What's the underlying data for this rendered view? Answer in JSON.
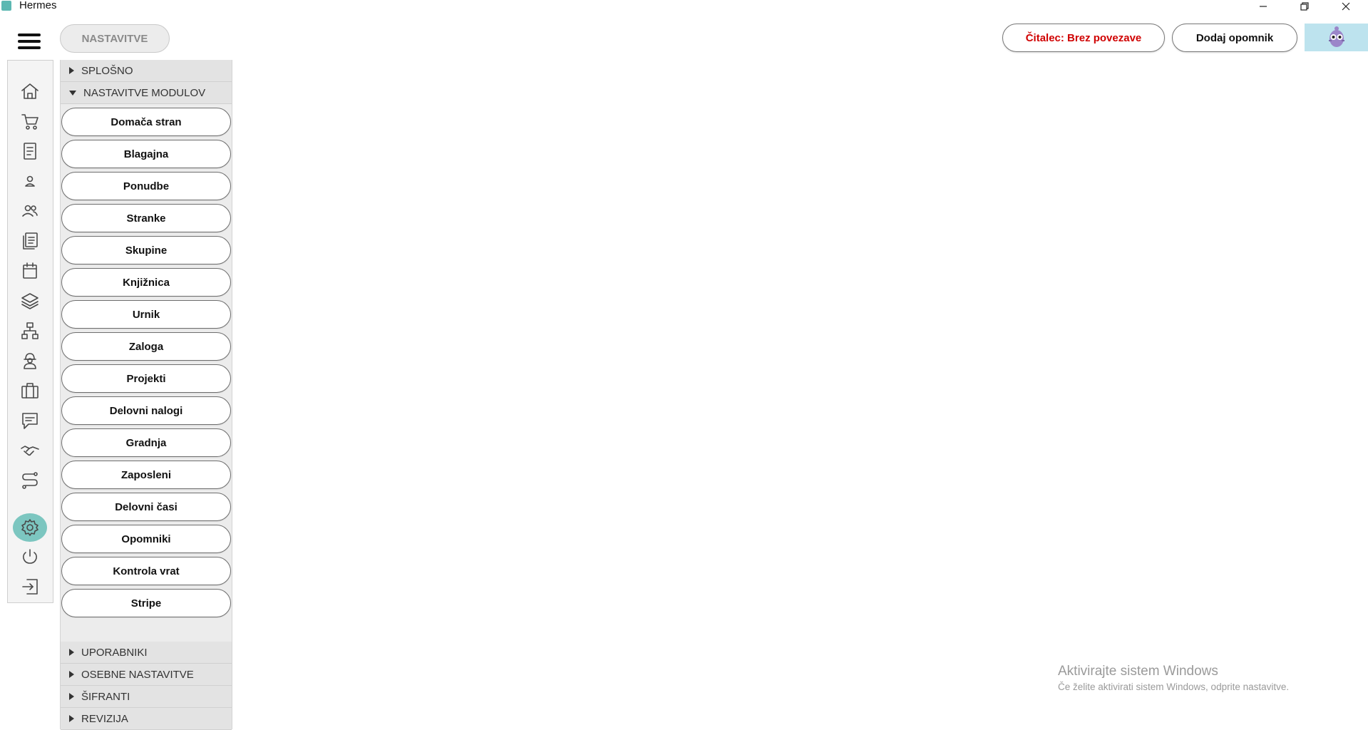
{
  "app": {
    "title": "Hermes"
  },
  "header": {
    "page_title": "NASTAVITVE",
    "reader_button": "Čitalec: Brez povezave",
    "reminder_button": "Dodaj opomnik",
    "reader_color": "#d00000"
  },
  "sidebar_icons": [
    "home-icon",
    "cart-icon",
    "document-icon",
    "user-icon",
    "users-icon",
    "list-icon",
    "calendar-icon",
    "layers-icon",
    "network-icon",
    "worker-icon",
    "briefcase-icon",
    "chat-icon",
    "handshake-icon",
    "route-icon",
    "gear-icon",
    "power-icon",
    "logout-icon"
  ],
  "active_icon": "gear-icon",
  "accent_color": "#7cc6c0",
  "panel": {
    "sections_top": [
      {
        "label": "SPLOŠNO",
        "expanded": false
      },
      {
        "label": "NASTAVITVE MODULOV",
        "expanded": true
      }
    ],
    "modules": [
      "Domača stran",
      "Blagajna",
      "Ponudbe",
      "Stranke",
      "Skupine",
      "Knjižnica",
      "Urnik",
      "Zaloga",
      "Projekti",
      "Delovni nalogi",
      "Gradnja",
      "Zaposleni",
      "Delovni časi",
      "Opomniki",
      "Kontrola vrat",
      "Stripe"
    ],
    "sections_bottom": [
      {
        "label": "UPORABNIKI",
        "expanded": false
      },
      {
        "label": "OSEBNE NASTAVITVE",
        "expanded": false
      },
      {
        "label": "ŠIFRANTI",
        "expanded": false
      },
      {
        "label": "REVIZIJA",
        "expanded": false
      }
    ]
  },
  "watermark": {
    "title": "Aktivirajte sistem Windows",
    "subtitle": "Če želite aktivirati sistem Windows, odprite nastavitve."
  }
}
